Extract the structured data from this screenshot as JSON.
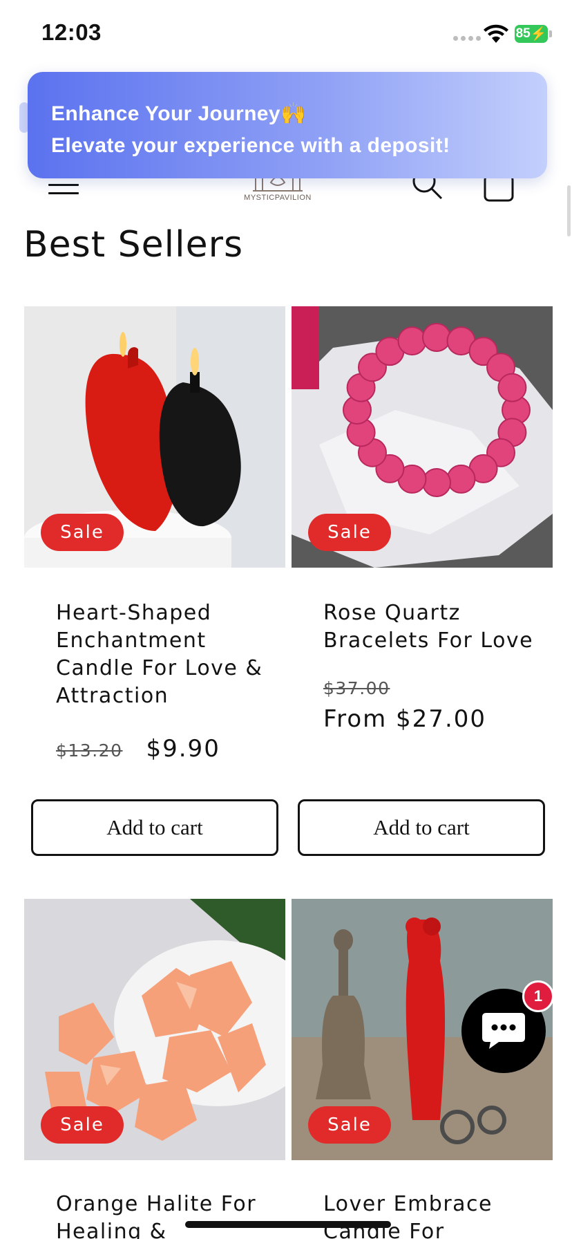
{
  "status_bar": {
    "time": "12:03",
    "battery": "85"
  },
  "banner": {
    "title": "Enhance Your Journey🙌",
    "subtitle": "Elevate your experience with a deposit!"
  },
  "header": {
    "logo_text": "MYSTICPAVILION",
    "icons": [
      "menu-icon",
      "logo-icon",
      "search-icon",
      "cart-icon"
    ]
  },
  "section_title": "Best Sellers",
  "products": [
    {
      "badge": "Sale",
      "title": "Heart-Shaped Enchantment Candle For Love & Attraction",
      "old_price": "$13.20",
      "price": "$9.90",
      "button": "Add to cart"
    },
    {
      "badge": "Sale",
      "title": "Rose Quartz Bracelets For Love",
      "old_price": "$37.00",
      "price": "From $27.00",
      "button": "Add to cart"
    },
    {
      "badge": "Sale",
      "title": "Orange Halite For Healing &"
    },
    {
      "badge": "Sale",
      "title": "Lover Embrace Candle For"
    }
  ],
  "chat": {
    "badge_count": "1",
    "icon": "chat-icon"
  },
  "colors": {
    "sale": "#e12b2b",
    "banner_start": "#5b72ef",
    "banner_end": "#c3cffc",
    "chat_badge": "#e01c3f",
    "battery": "#34c759"
  }
}
